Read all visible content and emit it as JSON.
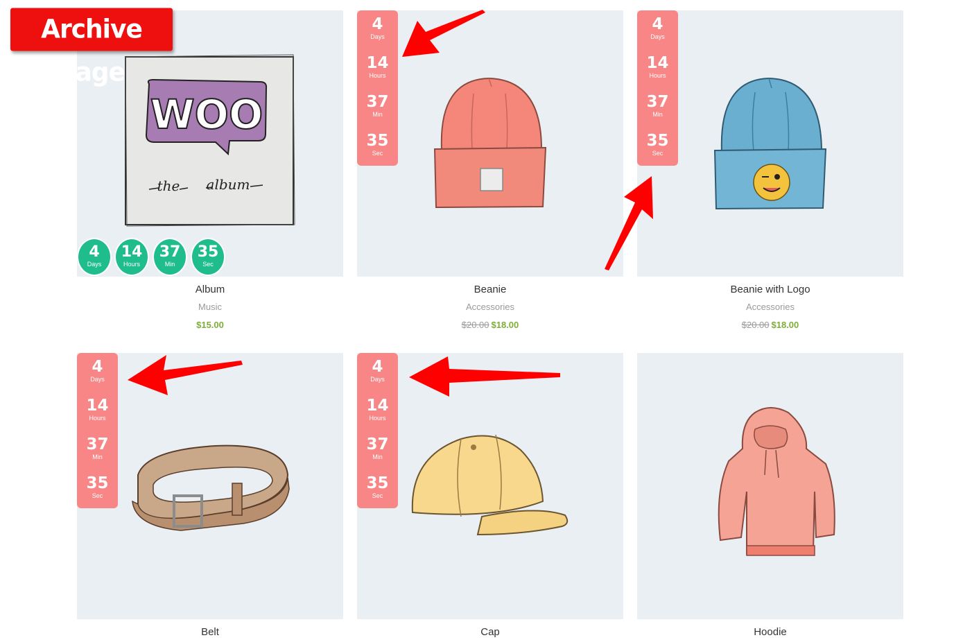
{
  "badge": {
    "text": "Archive Page",
    "color": "#ee0f0f"
  },
  "colors": {
    "vertical_countdown": "#f98686",
    "circle_countdown": "#1fbd8c",
    "sale_price": "#7fad39",
    "image_bg": "#eaeff3"
  },
  "countdown": {
    "days": "4",
    "days_label": "Days",
    "hours": "14",
    "hours_label": "Hours",
    "min": "37",
    "min_label": "Min",
    "sec": "35",
    "sec_label": "Sec"
  },
  "products": [
    {
      "title": "Album",
      "category": "Music",
      "price": "$15.00",
      "old_price": "",
      "image": "woo-album-cover",
      "countdown_style": "circles"
    },
    {
      "title": "Beanie",
      "category": "Accessories",
      "price": "$18.00",
      "old_price": "$20.00",
      "image": "orange-beanie",
      "countdown_style": "vertical"
    },
    {
      "title": "Beanie with Logo",
      "category": "Accessories",
      "price": "$18.00",
      "old_price": "$20.00",
      "image": "blue-beanie-with-logo",
      "countdown_style": "vertical"
    },
    {
      "title": "Belt",
      "image": "leather-belt",
      "countdown_style": "vertical"
    },
    {
      "title": "Cap",
      "image": "yellow-cap",
      "countdown_style": "vertical"
    },
    {
      "title": "Hoodie",
      "image": "pink-hoodie",
      "countdown_style": "none"
    }
  ],
  "album_art": {
    "logo_text": "WOO",
    "subtitle_left": "the",
    "subtitle_right": "album"
  }
}
